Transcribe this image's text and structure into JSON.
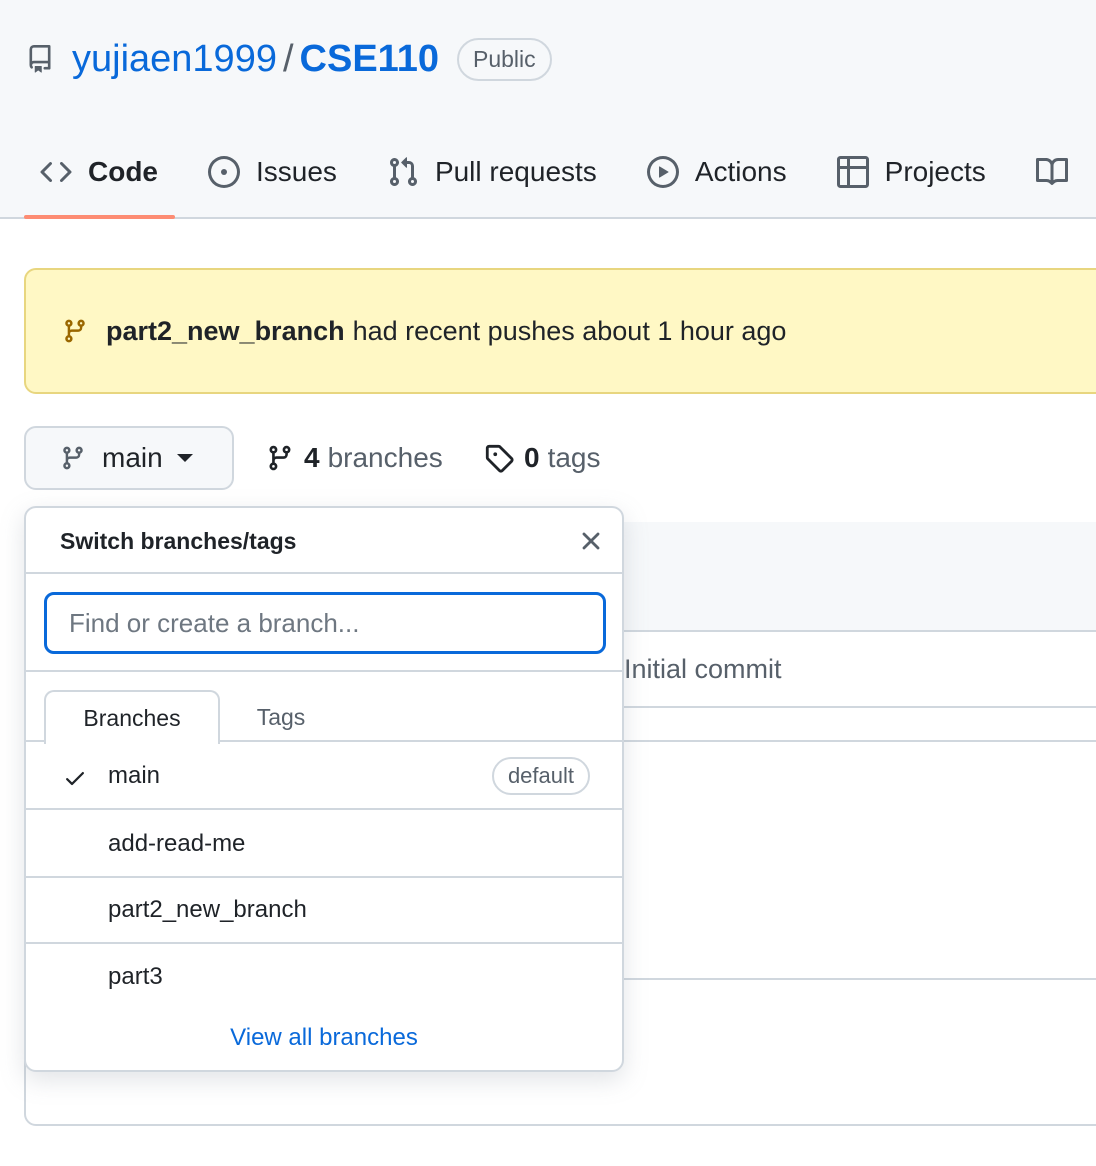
{
  "repo": {
    "owner": "yujiaen1999",
    "slash": "/",
    "name": "CSE110",
    "visibility": "Public"
  },
  "tabs": [
    {
      "label": "Code",
      "icon": "code-icon"
    },
    {
      "label": "Issues",
      "icon": "issue-icon"
    },
    {
      "label": "Pull requests",
      "icon": "pull-request-icon"
    },
    {
      "label": "Actions",
      "icon": "play-icon"
    },
    {
      "label": "Projects",
      "icon": "table-icon"
    }
  ],
  "flash": {
    "branch": "part2_new_branch",
    "text": "had recent pushes about 1 hour ago"
  },
  "branch_button": {
    "label": "main"
  },
  "meta": {
    "branches_count": "4",
    "branches_word": "branches",
    "tags_count": "0",
    "tags_word": "tags"
  },
  "background": {
    "commit_message": "Initial commit"
  },
  "dropdown": {
    "title": "Switch branches/tags",
    "placeholder": "Find or create a branch...",
    "tab_branches": "Branches",
    "tab_tags": "Tags",
    "items": [
      {
        "name": "main",
        "selected": true,
        "badge": "default"
      },
      {
        "name": "add-read-me"
      },
      {
        "name": "part2_new_branch"
      },
      {
        "name": "part3"
      }
    ],
    "view_all": "View all branches"
  },
  "colors": {
    "link": "#0969da",
    "tab_underline": "#fd8c73",
    "flash_bg": "#fff8c5",
    "flash_icon": "#9a6700"
  }
}
